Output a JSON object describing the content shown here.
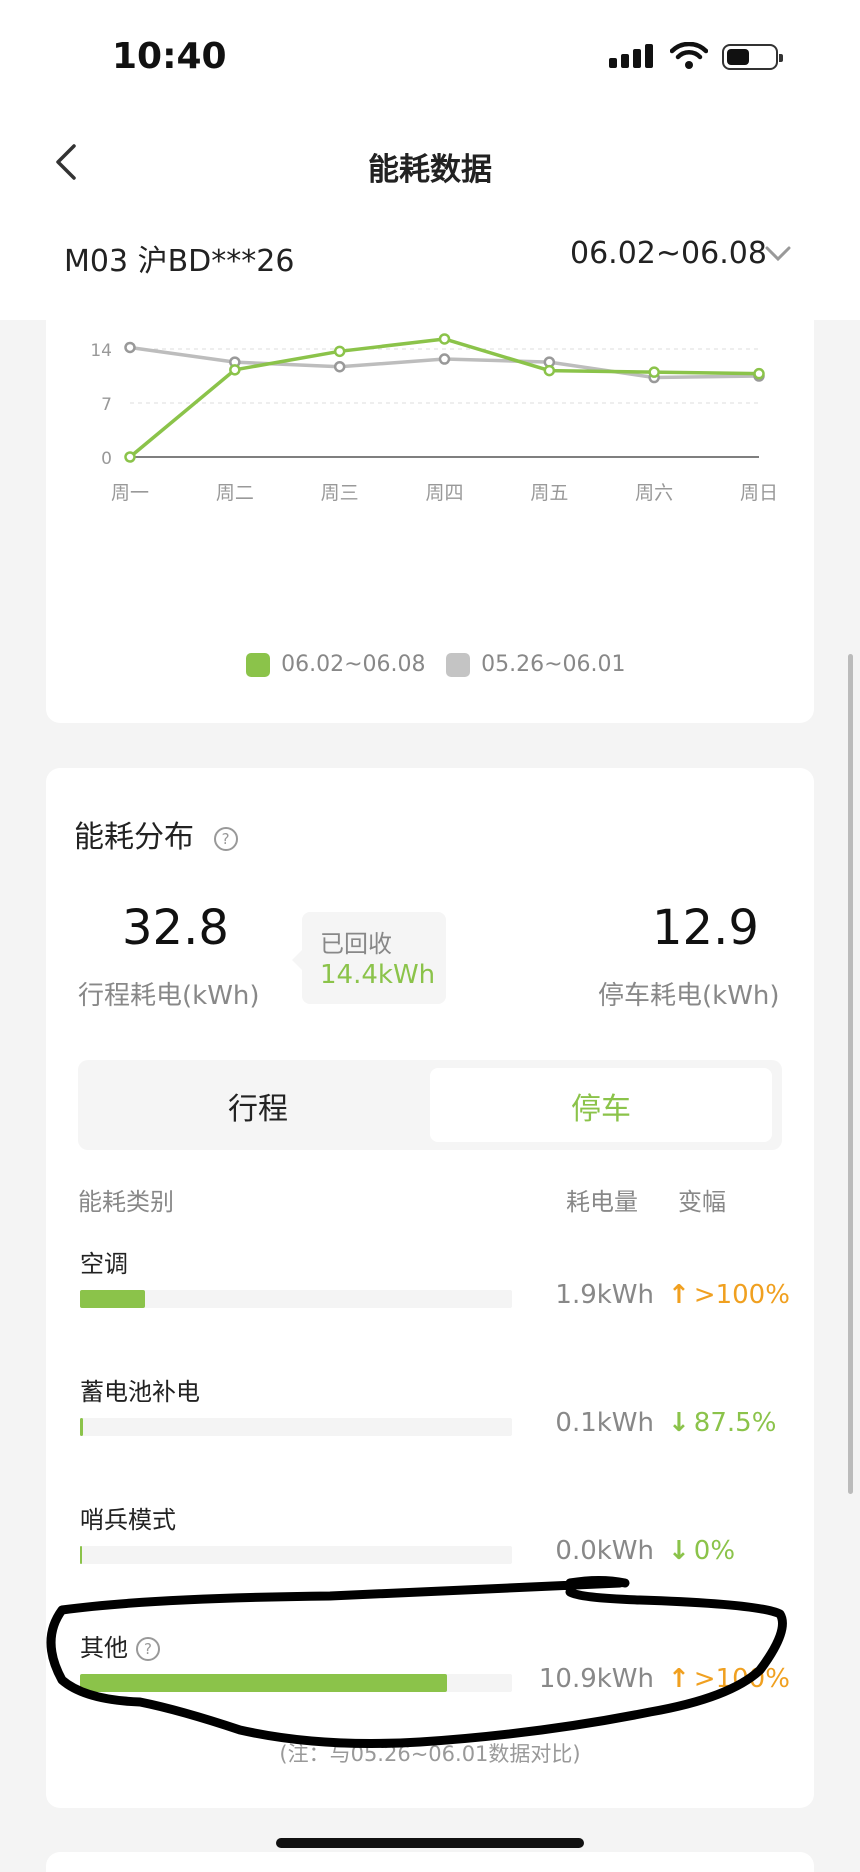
{
  "status_bar": {
    "time": "10:40"
  },
  "header": {
    "title": "能耗数据",
    "vehicle": "M03 沪BD***26",
    "date_range": "06.02~06.08"
  },
  "colors": {
    "accent_green": "#8bc34a",
    "grey_series": "#bdbdbd",
    "increase_orange": "#f0a020"
  },
  "chart_data": {
    "type": "line",
    "categories": [
      "周一",
      "周二",
      "周三",
      "周四",
      "周五",
      "周六",
      "周日"
    ],
    "y_ticks": [
      "0",
      "7",
      "14"
    ],
    "ylim": [
      0,
      21
    ],
    "grid": true,
    "legend_position": "bottom",
    "series": [
      {
        "name": "06.02~06.08",
        "color": "#8bc34a",
        "values": [
          0,
          11.3,
          13.7,
          15.3,
          11.2,
          11.0,
          10.8
        ]
      },
      {
        "name": "05.26~06.01",
        "color": "#bdbdbd",
        "values": [
          14.2,
          12.3,
          11.7,
          12.7,
          12.3,
          10.3,
          10.5
        ]
      }
    ]
  },
  "distribution": {
    "title": "能耗分布",
    "help_icon": "question-icon",
    "trip_value": "32.8",
    "trip_label": "行程耗电(kWh)",
    "parking_value": "12.9",
    "parking_label": "停车耗电(kWh)",
    "recovered_label": "已回收",
    "recovered_value": "14.4kWh",
    "tabs": [
      "行程",
      "停车"
    ],
    "active_tab": "停车",
    "columns": {
      "category": "能耗类别",
      "amount": "耗电量",
      "change": "变幅"
    },
    "rows": [
      {
        "name": "空调",
        "amount": "1.9kWh",
        "change": ">100%",
        "direction": "up",
        "share": 0.15
      },
      {
        "name": "蓄电池补电",
        "amount": "0.1kWh",
        "change": "87.5%",
        "direction": "down",
        "share": 0.008
      },
      {
        "name": "哨兵模式",
        "amount": "0.0kWh",
        "change": "0%",
        "direction": "down",
        "share": 0.0
      },
      {
        "name": "其他",
        "amount": "10.9kWh",
        "change": ">100%",
        "direction": "up",
        "share": 0.85
      }
    ],
    "note": "(注：与05.26~06.01数据对比)"
  }
}
